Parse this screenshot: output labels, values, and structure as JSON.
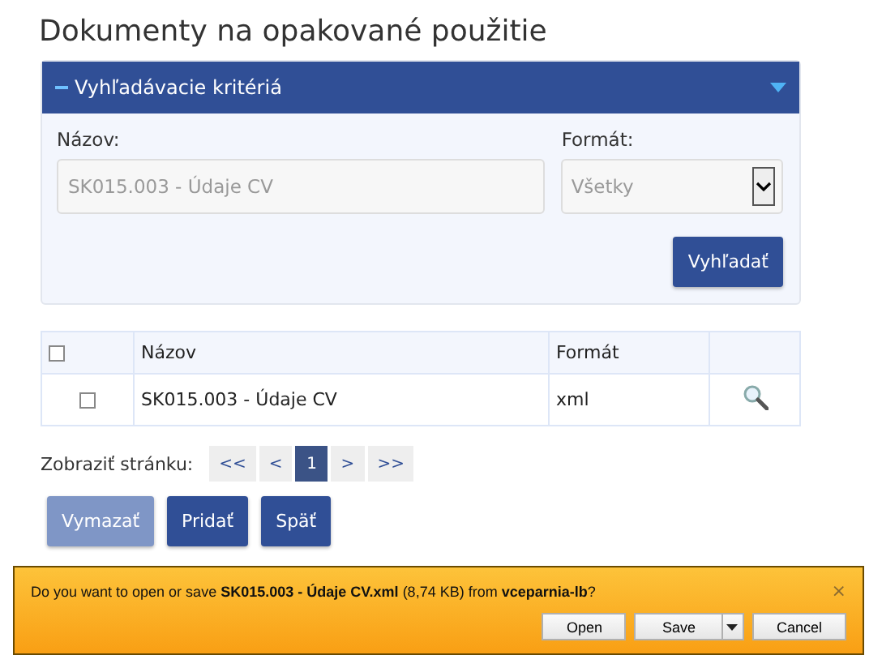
{
  "page_title": "Dokumenty na opakované použitie",
  "search_panel": {
    "title": "Vyhľadávacie kritériá",
    "expanded": true,
    "name_field": {
      "label": "Názov:",
      "placeholder": "SK015.003 - Údaje CV"
    },
    "format_field": {
      "label": "Formát:",
      "value": "Všetky"
    },
    "search_button": "Vyhľadať"
  },
  "table": {
    "select_all_checked": false,
    "columns": [
      "Názov",
      "Formát"
    ],
    "rows": [
      {
        "checked": false,
        "name": "SK015.003 - Údaje CV",
        "format": "xml"
      }
    ]
  },
  "pagination": {
    "label": "Zobraziť stránku:",
    "items": [
      {
        "label": "<<",
        "selected": false
      },
      {
        "label": "<",
        "selected": false
      },
      {
        "label": "1",
        "selected": true
      },
      {
        "label": ">",
        "selected": false
      },
      {
        "label": ">>",
        "selected": false
      }
    ]
  },
  "actions": [
    {
      "label": "Vymazať",
      "disabled": true
    },
    {
      "label": "Pridať",
      "disabled": false
    },
    {
      "label": "Späť",
      "disabled": false
    }
  ],
  "download_bar": {
    "message": "Do you want to open or save **SK015.003 - Údaje CV.xml** (8,74 KB) from **vceparnia-lb**?",
    "close": "×",
    "buttons": [
      "Open",
      "Save",
      "Cancel"
    ]
  }
}
